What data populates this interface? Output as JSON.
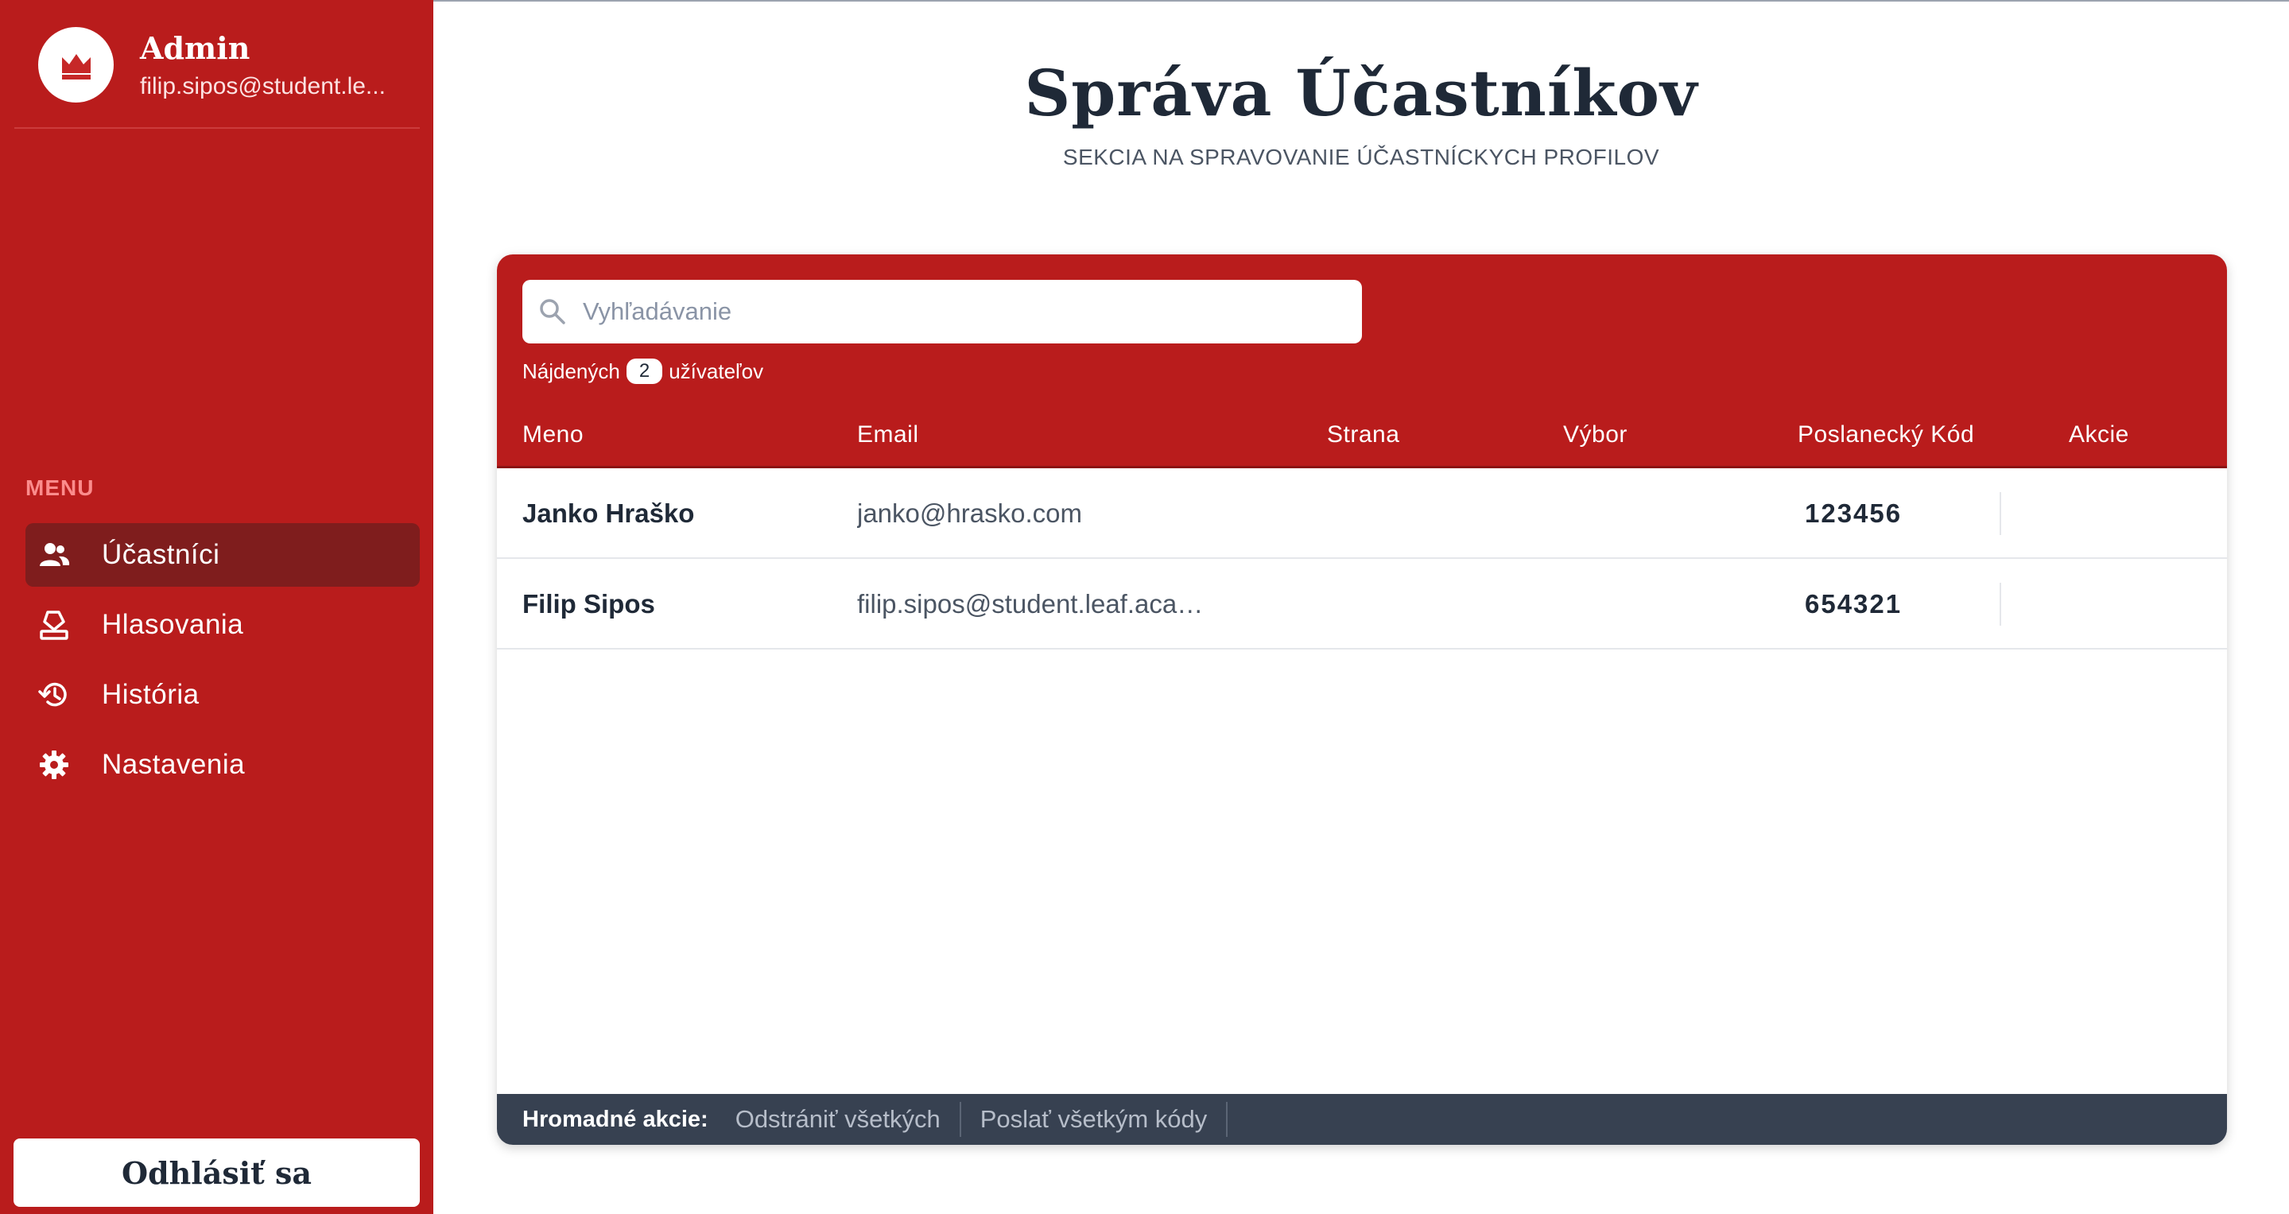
{
  "sidebar": {
    "profile": {
      "name": "Admin",
      "email": "filip.sipos@student.le..."
    },
    "menu_heading": "MENU",
    "items": [
      {
        "label": "Účastníci",
        "icon": "users-icon",
        "active": true
      },
      {
        "label": "Hlasovania",
        "icon": "ballot-box-icon",
        "active": false
      },
      {
        "label": "História",
        "icon": "history-icon",
        "active": false
      },
      {
        "label": "Nastavenia",
        "icon": "gear-icon",
        "active": false
      }
    ],
    "logout_label": "Odhlásiť sa"
  },
  "header": {
    "title": "Správa Účastníkov",
    "subtitle": "SEKCIA NA SPRAVOVANIE ÚČASTNÍCKYCH PROFILOV"
  },
  "search": {
    "placeholder": "Vyhľadávanie",
    "found_prefix": "Nájdených",
    "found_count": "2",
    "found_suffix": "užívateľov"
  },
  "table": {
    "columns": [
      "Meno",
      "Email",
      "Strana",
      "Výbor",
      "Poslanecký Kód",
      "Akcie"
    ],
    "rows": [
      {
        "name": "Janko Hraško",
        "email": "janko@hrasko.com",
        "party": "",
        "committee": "",
        "code": "123456"
      },
      {
        "name": "Filip Sipos",
        "email": "filip.sipos@student.leaf.acad...",
        "party": "",
        "committee": "",
        "code": "654321"
      }
    ]
  },
  "bulk": {
    "label": "Hromadné akcie:",
    "actions": [
      "Odstrániť všetkých",
      "Poslať všetkým kódy"
    ]
  },
  "colors": {
    "brand_red": "#b91c1c",
    "active_red": "#7f1d1d",
    "dark_slate": "#374151"
  }
}
